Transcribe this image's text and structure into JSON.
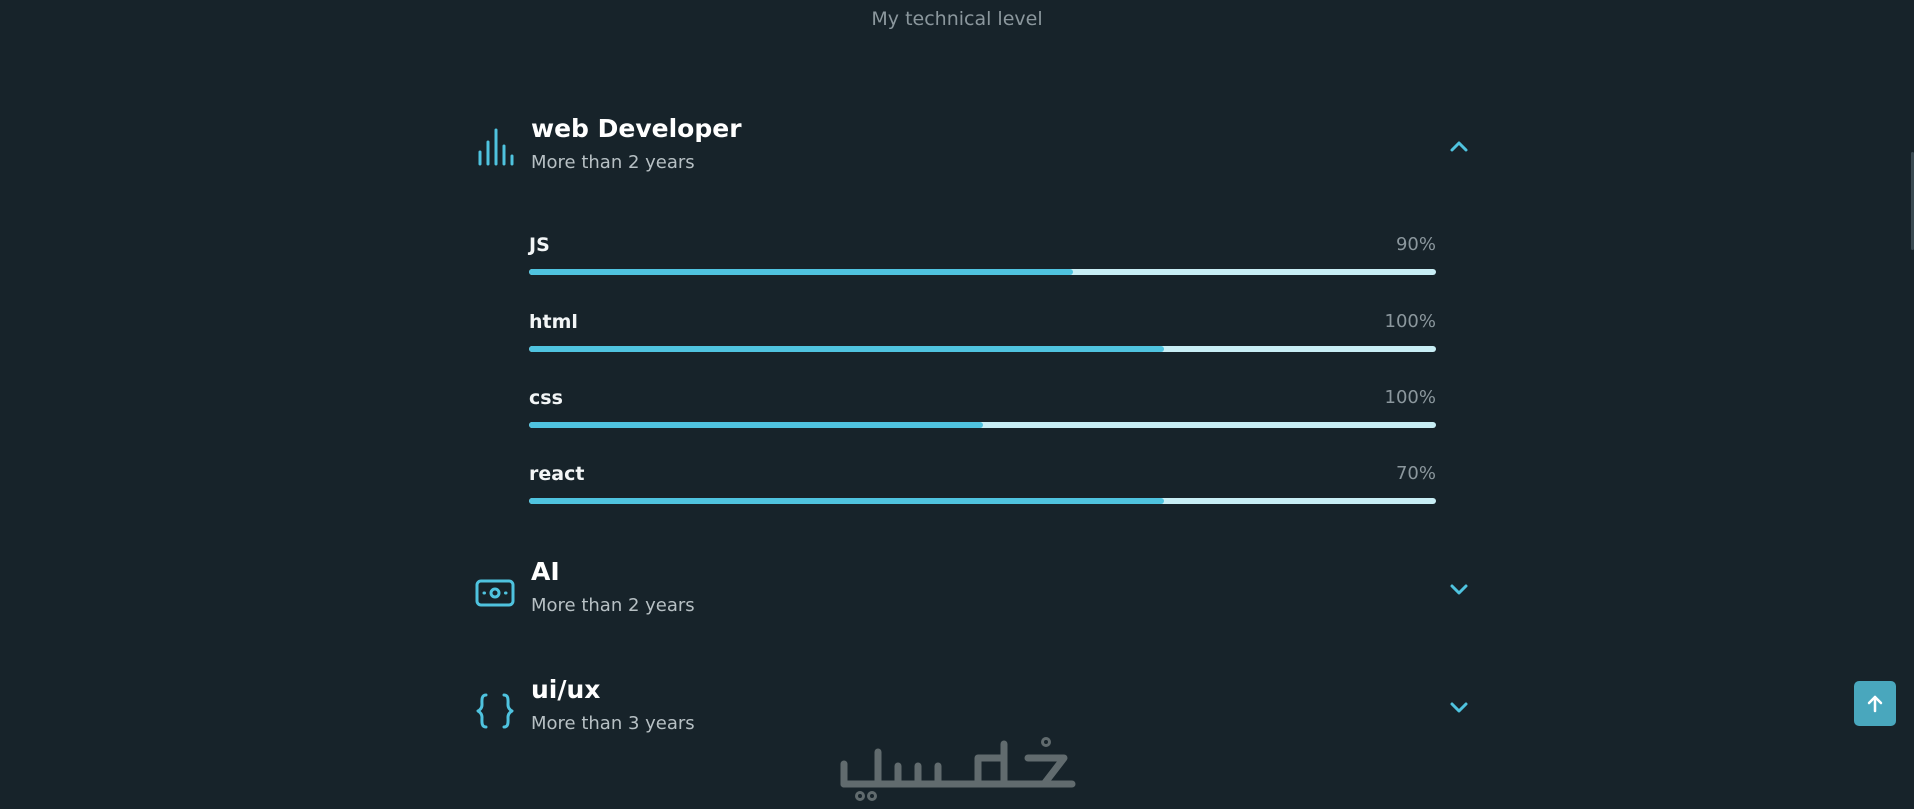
{
  "section": {
    "subtitle": "My technical level"
  },
  "colors": {
    "accent": "#4fc3df",
    "background": "#17232a",
    "track": "#c8eef5",
    "button": "#49a7bd"
  },
  "groups": [
    {
      "title": "web Developer",
      "subtitle": "More than 2 years",
      "icon": "bar-chart-icon",
      "expanded": true,
      "skills": [
        {
          "name": "JS",
          "percent_label": "90%",
          "fill_fraction": 0.6
        },
        {
          "name": "html",
          "percent_label": "100%",
          "fill_fraction": 0.7
        },
        {
          "name": "css",
          "percent_label": "100%",
          "fill_fraction": 0.5
        },
        {
          "name": "react",
          "percent_label": "70%",
          "fill_fraction": 0.7
        }
      ]
    },
    {
      "title": "AI",
      "subtitle": "More than 2 years",
      "icon": "banknote-icon",
      "expanded": false
    },
    {
      "title": "ui/ux",
      "subtitle": "More than 3 years",
      "icon": "braces-icon",
      "expanded": false
    }
  ],
  "watermark": {
    "icon": "khamsat-logo"
  },
  "back_to_top": {
    "icon": "arrow-up-icon"
  }
}
